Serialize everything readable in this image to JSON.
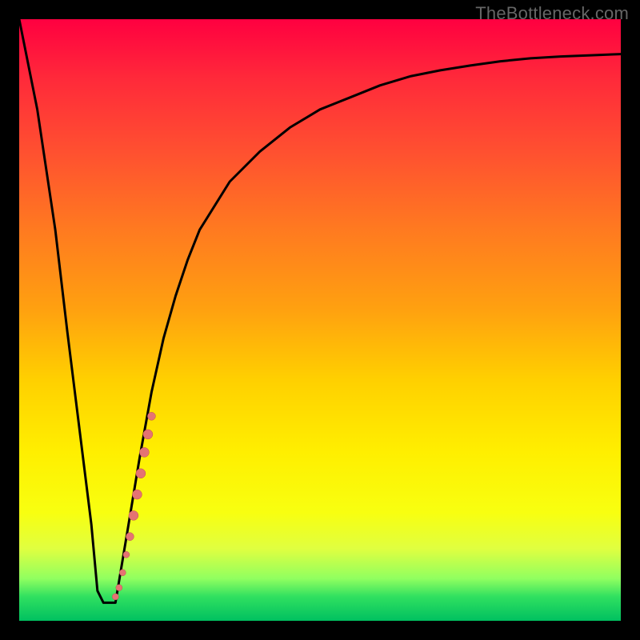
{
  "watermark": "TheBottleneck.com",
  "colors": {
    "curve": "#000000",
    "marker": "#e57373",
    "marker_stroke": "#c05050",
    "gradient_top": "#ff0040",
    "gradient_bottom": "#00c060",
    "frame": "#000000"
  },
  "chart_data": {
    "type": "line",
    "title": "",
    "xlabel": "",
    "ylabel": "",
    "xlim": [
      0,
      100
    ],
    "ylim": [
      0,
      100
    ],
    "grid": false,
    "legend": false,
    "series": [
      {
        "name": "bottleneck-curve",
        "x": [
          0,
          3,
          6,
          8,
          10,
          12,
          13,
          14,
          16,
          18,
          20,
          22,
          24,
          26,
          28,
          30,
          35,
          40,
          45,
          50,
          55,
          60,
          65,
          70,
          75,
          80,
          85,
          90,
          95,
          100
        ],
        "values": [
          100,
          85,
          65,
          48,
          32,
          16,
          5,
          3,
          3,
          15,
          27,
          38,
          47,
          54,
          60,
          65,
          73,
          78,
          82,
          85,
          87,
          89,
          90.5,
          91.5,
          92.3,
          93,
          93.5,
          93.8,
          94,
          94.2
        ]
      }
    ],
    "markers": {
      "name": "highlight-dots",
      "color": "#e57373",
      "points": [
        {
          "x": 16.0,
          "y": 4.0,
          "r": 4
        },
        {
          "x": 16.6,
          "y": 5.5,
          "r": 4
        },
        {
          "x": 17.2,
          "y": 8.0,
          "r": 4
        },
        {
          "x": 17.8,
          "y": 11.0,
          "r": 4
        },
        {
          "x": 18.4,
          "y": 14.0,
          "r": 5
        },
        {
          "x": 19.0,
          "y": 17.5,
          "r": 6
        },
        {
          "x": 19.6,
          "y": 21.0,
          "r": 6
        },
        {
          "x": 20.2,
          "y": 24.5,
          "r": 6
        },
        {
          "x": 20.8,
          "y": 28.0,
          "r": 6
        },
        {
          "x": 21.4,
          "y": 31.0,
          "r": 6
        },
        {
          "x": 22.0,
          "y": 34.0,
          "r": 5
        }
      ]
    }
  }
}
